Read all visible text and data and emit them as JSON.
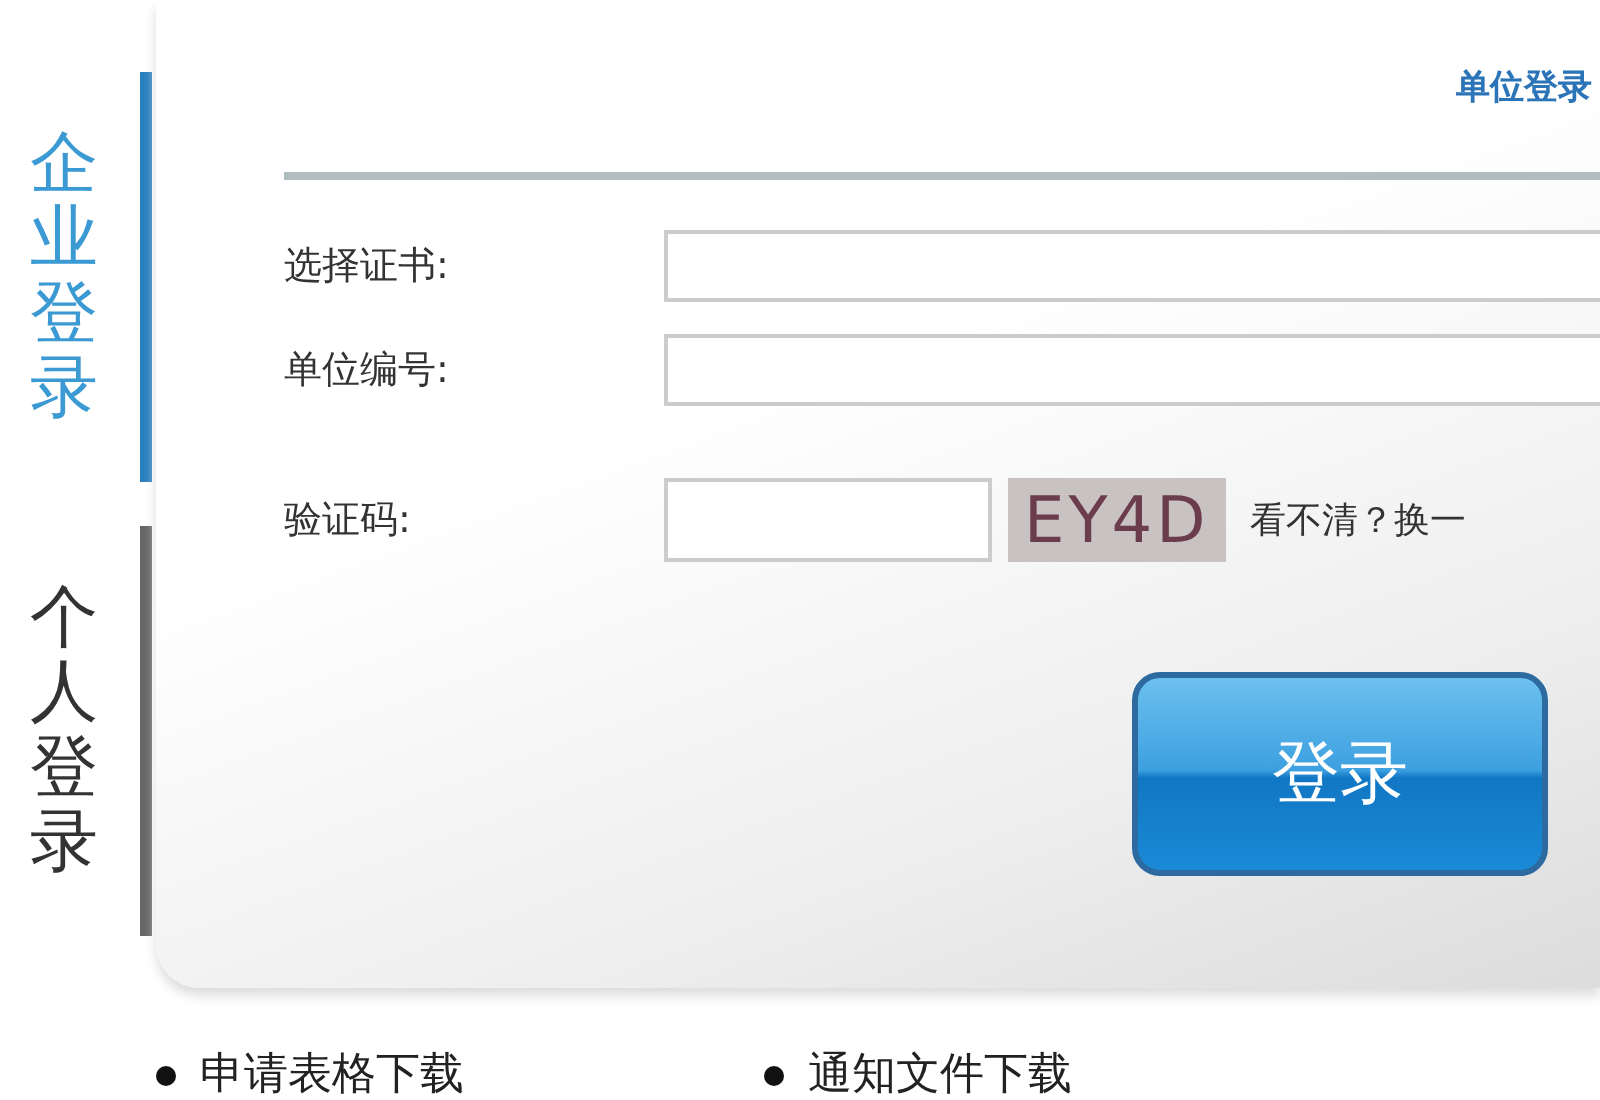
{
  "tabs": [
    {
      "label": "企业登录",
      "selected": true
    },
    {
      "label": "个人登录",
      "selected": false
    }
  ],
  "panel": {
    "title": "单位登录",
    "fields": [
      {
        "label": "选择证书:",
        "kind": "wide"
      },
      {
        "label": "单位编号:",
        "kind": "wide"
      },
      {
        "label": "验证码:",
        "kind": "captcha"
      }
    ],
    "captcha": {
      "code": "EY4D",
      "refresh_link": "看不清？换一"
    },
    "login_button": "登录"
  },
  "downloads": [
    "申请表格下载",
    "通知文件下载"
  ]
}
